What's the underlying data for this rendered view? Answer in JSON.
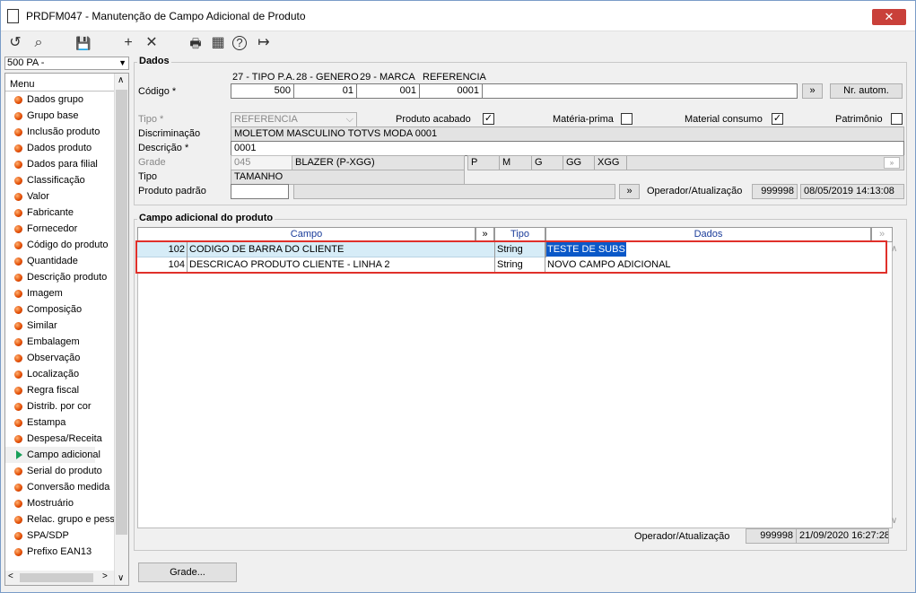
{
  "window": {
    "title": "PRDFM047 - Manutenção de Campo Adicional de Produto",
    "close_label": "✕"
  },
  "toolbar": {
    "refresh": "↺",
    "search": "⌕",
    "save": "💾",
    "add": "+",
    "delete": "✕",
    "print": "🖶",
    "calendar": "▦",
    "help": "?",
    "exit": "↦"
  },
  "company_combo": {
    "value": "500 PA - "
  },
  "menu": {
    "header": "Menu",
    "items": [
      {
        "label": "Dados grupo"
      },
      {
        "label": "Grupo base"
      },
      {
        "label": "Inclusão produto"
      },
      {
        "label": "Dados produto"
      },
      {
        "label": "Dados para filial"
      },
      {
        "label": "Classificação"
      },
      {
        "label": "Valor"
      },
      {
        "label": "Fabricante"
      },
      {
        "label": "Fornecedor"
      },
      {
        "label": "Código do produto"
      },
      {
        "label": "Quantidade"
      },
      {
        "label": "Descrição produto"
      },
      {
        "label": "Imagem"
      },
      {
        "label": "Composição"
      },
      {
        "label": "Similar"
      },
      {
        "label": "Embalagem"
      },
      {
        "label": "Observação"
      },
      {
        "label": "Localização"
      },
      {
        "label": "Regra fiscal"
      },
      {
        "label": "Distrib. por cor"
      },
      {
        "label": "Estampa"
      },
      {
        "label": "Despesa/Receita"
      },
      {
        "label": "Campo adicional"
      },
      {
        "label": "Serial do produto"
      },
      {
        "label": "Conversão medida"
      },
      {
        "label": "Mostruário"
      },
      {
        "label": "Relac. grupo e pess"
      },
      {
        "label": "SPA/SDP"
      },
      {
        "label": "Prefixo EAN13"
      }
    ],
    "active_index": 22
  },
  "dados": {
    "legend": "Dados",
    "codigo_label": "Código *",
    "col_headers": [
      "27 - TIPO P.A.",
      "28 - GENERO",
      "29 - MARCA",
      "REFERENCIA"
    ],
    "codigo_values": [
      "500",
      "01",
      "001",
      "0001"
    ],
    "more_button": "»",
    "nr_autom_button": "Nr. autom.",
    "tipo_label": "Tipo *",
    "tipo_value": "REFERENCIA",
    "produto_acabado_label": "Produto acabado",
    "materia_prima_label": "Matéria-prima",
    "material_consumo_label": "Material consumo",
    "patrimonio_label": "Patrimônio",
    "discriminacao_label": "Discriminação",
    "discriminacao_value": "MOLETOM MASCULINO TOTVS MODA 0001",
    "descricao_label": "Descrição *",
    "descricao_value": "0001",
    "grade_label": "Grade",
    "grade_code": "045",
    "grade_desc": "BLAZER (P-XGG)",
    "sizes": [
      "P",
      "M",
      "G",
      "GG",
      "XGG"
    ],
    "tipo2_label": "Tipo",
    "tipo2_value": "TAMANHO",
    "produto_padrao_label": "Produto padrão",
    "operador_label": "Operador/Atualização",
    "operador_value": "999998",
    "atualizacao_value": "08/05/2019 14:13:08"
  },
  "campo_adicional": {
    "legend": "Campo adicional do produto",
    "headers": {
      "campo": "Campo",
      "expand": "»",
      "tipo": "Tipo",
      "dados": "Dados"
    },
    "rows": [
      {
        "code": "102",
        "campo": "CODIGO DE BARRA DO CLIENTE",
        "tipo": "String",
        "dados": "TESTE DE SUBS"
      },
      {
        "code": "104",
        "campo": "DESCRICAO PRODUTO CLIENTE - LINHA 2",
        "tipo": "String",
        "dados": "NOVO CAMPO ADICIONAL"
      }
    ],
    "operador_label": "Operador/Atualização",
    "operador_value": "999998",
    "atualizacao_value": "21/09/2020 16:27:28"
  },
  "footer": {
    "grade_button": "Grade..."
  }
}
